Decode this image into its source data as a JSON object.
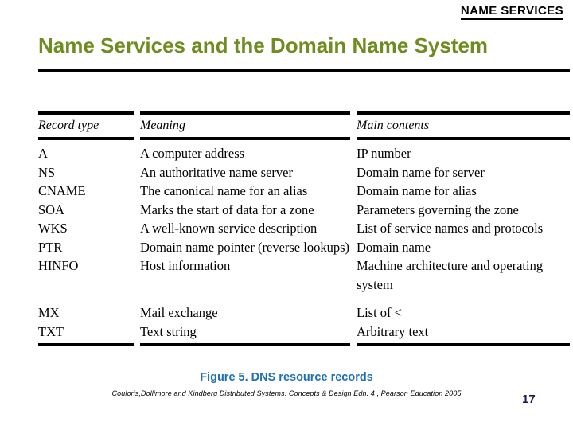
{
  "slide": {
    "header": "NAME SERVICES",
    "title": "Name Services and the Domain Name System",
    "page_number": "17",
    "colors": {
      "title": "#6f8c20",
      "caption": "#1f6fb5",
      "page_number": "#1b1b4f",
      "rule": "#000000"
    }
  },
  "table": {
    "headers": {
      "record_type": "Record type",
      "meaning": "Meaning",
      "main_contents": "Main contents"
    },
    "rows": [
      {
        "record_type": "A",
        "meaning": "A computer address",
        "main_contents": "IP number"
      },
      {
        "record_type": "NS",
        "meaning": "An authoritative name server",
        "main_contents": "Domain name for server"
      },
      {
        "record_type": "CNAME",
        "meaning": "The canonical name for an alias",
        "main_contents": "Domain name for alias"
      },
      {
        "record_type": "SOA",
        "meaning": "Marks the start of data for a zone",
        "main_contents": "Parameters governing the zone"
      },
      {
        "record_type": "WKS",
        "meaning": "A well-known service description",
        "main_contents": "List of service names and protocols"
      },
      {
        "record_type": "PTR",
        "meaning": "Domain name pointer (reverse lookups)",
        "main_contents": "Domain name"
      },
      {
        "record_type": "HINFO",
        "meaning": "Host information",
        "main_contents": "Machine architecture and operating system"
      },
      {
        "record_type": "MX",
        "meaning": "Mail exchange",
        "main_contents": "List of <"
      },
      {
        "record_type": "TXT",
        "meaning": "Text string",
        "main_contents": "Arbitrary text"
      }
    ]
  },
  "caption": {
    "figure": "Figure 5. DNS resource records",
    "attribution": "Couloris,Dollimore and Kindberg  Distributed Systems: Concepts & Design  Edn. 4 , Pearson Education 2005"
  }
}
